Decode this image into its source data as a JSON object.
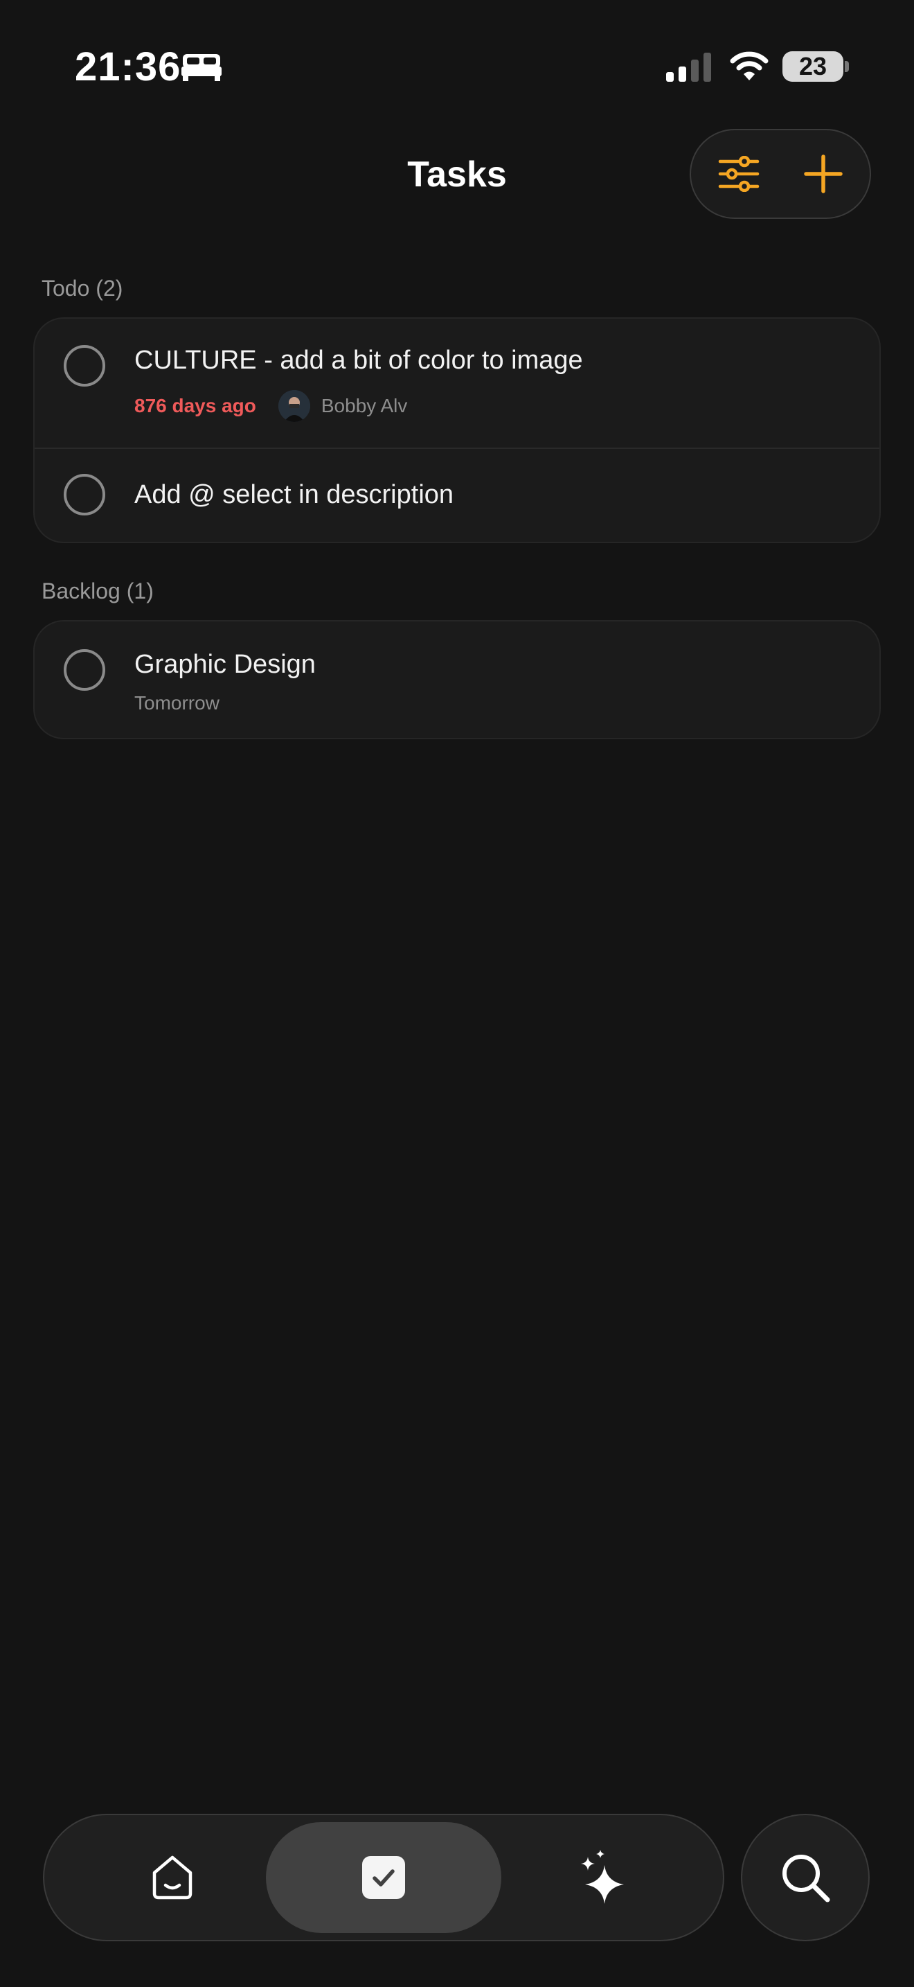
{
  "status_bar": {
    "time": "21:36",
    "battery": "23",
    "icons": [
      "bed-icon",
      "signal-icon",
      "wifi-icon",
      "battery-icon"
    ]
  },
  "header": {
    "title": "Tasks",
    "actions": [
      "filter-sliders-icon",
      "plus-icon"
    ],
    "accent_color": "#F5A623"
  },
  "sections": [
    {
      "label": "Todo (2)",
      "tasks": [
        {
          "title": "CULTURE - add a bit of color to image",
          "due": "876 days ago",
          "due_status": "overdue",
          "assignee": "Bobby Alv"
        },
        {
          "title": "Add @ select in description"
        }
      ]
    },
    {
      "label": "Backlog (1)",
      "tasks": [
        {
          "title": "Graphic Design",
          "due": "Tomorrow"
        }
      ]
    }
  ],
  "colors": {
    "background": "#141414",
    "card": "#1B1B1B",
    "overdue": "#EF5A5A"
  },
  "tab_bar": {
    "tabs": [
      {
        "icon": "home-icon",
        "selected": false
      },
      {
        "icon": "checkbox-icon",
        "selected": true
      },
      {
        "icon": "sparkles-icon",
        "selected": false
      }
    ],
    "search_icon": "search-icon"
  }
}
